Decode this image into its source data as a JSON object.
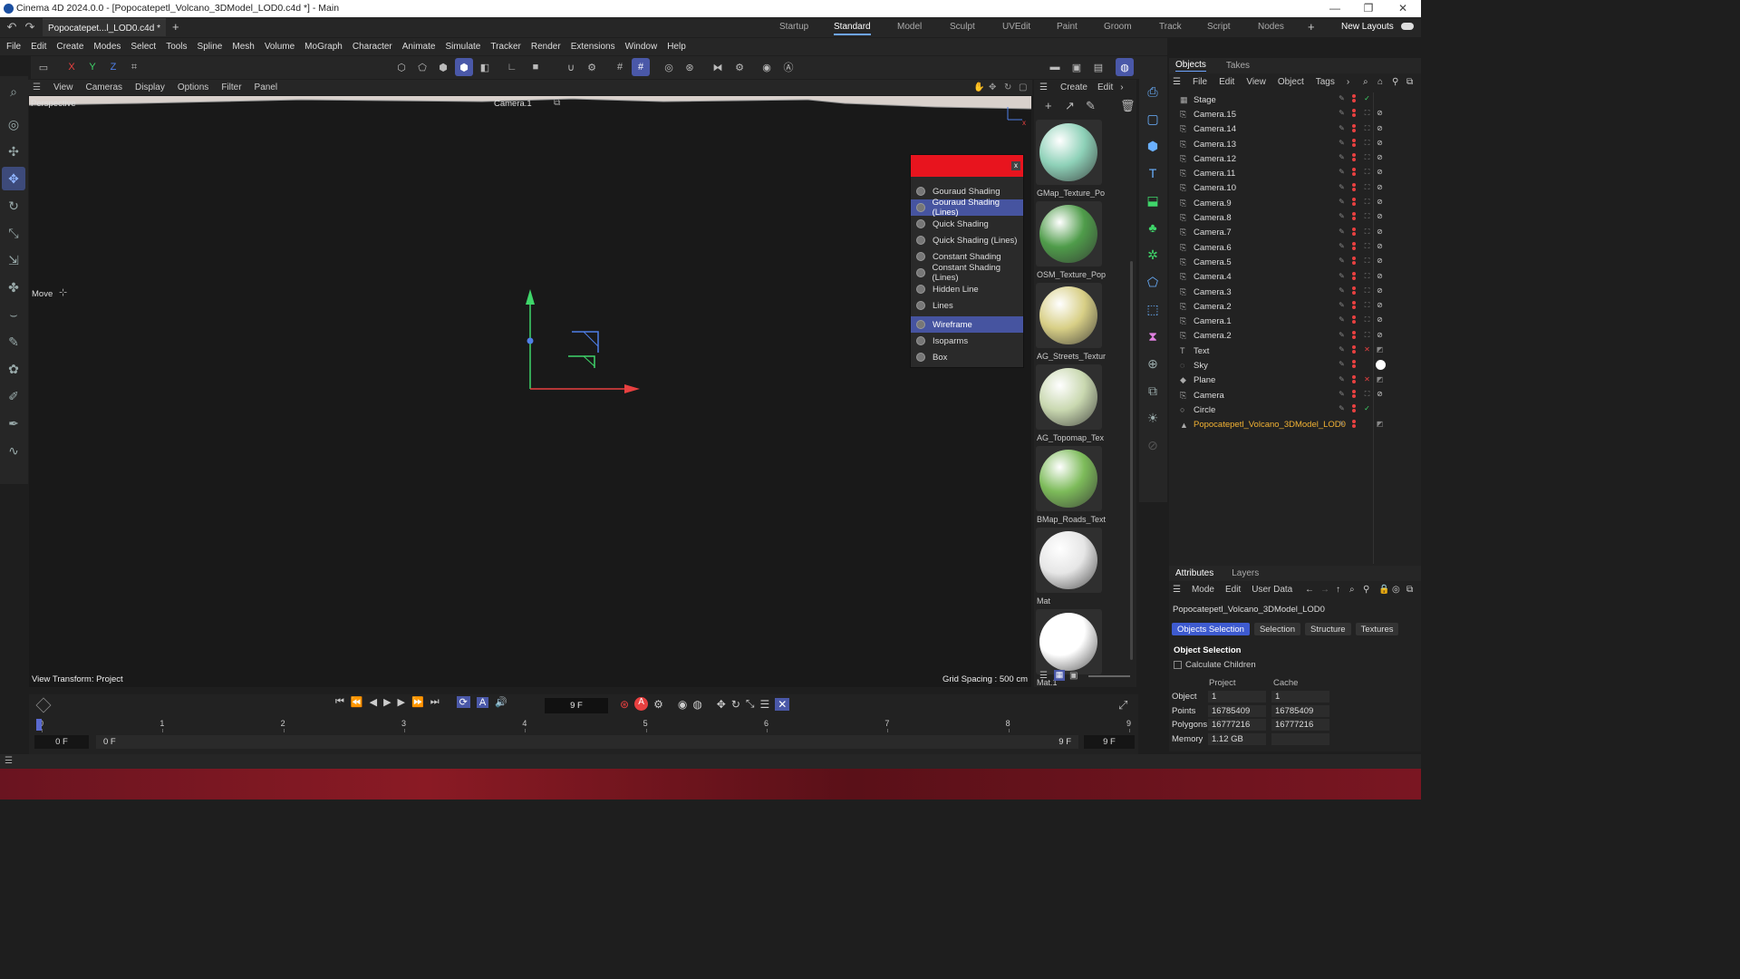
{
  "titlebar": {
    "title": "Cinema 4D 2024.0.0 - [Popocatepetl_Volcano_3DModel_LOD0.c4d *] - Main",
    "minimize": "—",
    "maximize": "❐",
    "close": "✕"
  },
  "doc_tab": {
    "label": "Popocatepet...l_LOD0.c4d *",
    "close": "✕",
    "add": "+"
  },
  "layouts": [
    {
      "label": "Startup",
      "active": false
    },
    {
      "label": "Standard",
      "active": true
    },
    {
      "label": "Model",
      "active": false
    },
    {
      "label": "Sculpt",
      "active": false
    },
    {
      "label": "UVEdit",
      "active": false
    },
    {
      "label": "Paint",
      "active": false
    },
    {
      "label": "Groom",
      "active": false
    },
    {
      "label": "Track",
      "active": false
    },
    {
      "label": "Script",
      "active": false
    },
    {
      "label": "Nodes",
      "active": false
    }
  ],
  "new_layouts": "New Layouts",
  "menu": [
    "File",
    "Edit",
    "Create",
    "Modes",
    "Select",
    "Tools",
    "Spline",
    "Mesh",
    "Volume",
    "MoGraph",
    "Character",
    "Animate",
    "Simulate",
    "Tracker",
    "Render",
    "Extensions",
    "Window",
    "Help"
  ],
  "axis_toggles": [
    "X",
    "Y",
    "Z"
  ],
  "viewport_menu": [
    "View",
    "Cameras",
    "Display",
    "Options",
    "Filter",
    "Panel"
  ],
  "viewport": {
    "name": "Perspective",
    "camera": "Camera.1",
    "tool": "Move",
    "view_transform": "View Transform: Project",
    "grid_spacing": "Grid Spacing : 500 cm"
  },
  "shading_popup": {
    "close": "x",
    "items": [
      {
        "label": "Gouraud Shading",
        "selected": false
      },
      {
        "label": "Gouraud Shading (Lines)",
        "selected": true
      },
      {
        "label": "Quick Shading",
        "selected": false
      },
      {
        "label": "Quick Shading (Lines)",
        "selected": false
      },
      {
        "label": "Constant Shading",
        "selected": false
      },
      {
        "label": "Constant Shading (Lines)",
        "selected": false
      },
      {
        "label": "Hidden Line",
        "selected": false
      },
      {
        "label": "Lines",
        "selected": false
      }
    ],
    "items2": [
      {
        "label": "Wireframe",
        "selected": true
      },
      {
        "label": "Isoparms",
        "selected": false
      },
      {
        "label": "Box",
        "selected": false
      }
    ]
  },
  "material_menu": [
    "Create",
    "Edit"
  ],
  "materials": [
    {
      "name": "GMap_Texture_Po",
      "color": "#8ed1b8"
    },
    {
      "name": "OSM_Texture_Pop",
      "color": "#4f9c4a"
    },
    {
      "name": "AG_Streets_Textur",
      "color": "#d8cf86"
    },
    {
      "name": "AG_Topomap_Tex",
      "color": "#c9d8b0"
    },
    {
      "name": "BMap_Roads_Text",
      "color": "#7dbb5a"
    },
    {
      "name": "Mat",
      "color": "#e6e6e6"
    },
    {
      "name": "Mat.1",
      "color": "#ffffff"
    }
  ],
  "objects_tabs": [
    "Objects",
    "Takes"
  ],
  "objects_menu": [
    "File",
    "Edit",
    "View",
    "Object",
    "Tags"
  ],
  "objects": [
    {
      "name": "Stage",
      "icon": "stage-icon",
      "glyph": "▦",
      "tag": "check"
    },
    {
      "name": "Camera.15",
      "icon": "camera-icon",
      "glyph": "⎘",
      "tag": "target"
    },
    {
      "name": "Camera.14",
      "icon": "camera-icon",
      "glyph": "⎘",
      "tag": "target"
    },
    {
      "name": "Camera.13",
      "icon": "camera-icon",
      "glyph": "⎘",
      "tag": "target"
    },
    {
      "name": "Camera.12",
      "icon": "camera-icon",
      "glyph": "⎘",
      "tag": "target"
    },
    {
      "name": "Camera.11",
      "icon": "camera-icon",
      "glyph": "⎘",
      "tag": "target"
    },
    {
      "name": "Camera.10",
      "icon": "camera-icon",
      "glyph": "⎘",
      "tag": "target"
    },
    {
      "name": "Camera.9",
      "icon": "camera-icon",
      "glyph": "⎘",
      "tag": "target"
    },
    {
      "name": "Camera.8",
      "icon": "camera-icon",
      "glyph": "⎘",
      "tag": "target"
    },
    {
      "name": "Camera.7",
      "icon": "camera-icon",
      "glyph": "⎘",
      "tag": "target"
    },
    {
      "name": "Camera.6",
      "icon": "camera-icon",
      "glyph": "⎘",
      "tag": "target"
    },
    {
      "name": "Camera.5",
      "icon": "camera-icon",
      "glyph": "⎘",
      "tag": "target"
    },
    {
      "name": "Camera.4",
      "icon": "camera-icon",
      "glyph": "⎘",
      "tag": "target"
    },
    {
      "name": "Camera.3",
      "icon": "camera-icon",
      "glyph": "⎘",
      "tag": "target"
    },
    {
      "name": "Camera.2",
      "icon": "camera-icon",
      "glyph": "⎘",
      "tag": "target"
    },
    {
      "name": "Camera.1",
      "icon": "camera-icon",
      "glyph": "⎘",
      "tag": "target"
    },
    {
      "name": "Camera.2",
      "icon": "camera-icon",
      "glyph": "⎘",
      "tag": "target"
    },
    {
      "name": "Text",
      "icon": "text-icon",
      "glyph": "T",
      "tag": "x"
    },
    {
      "name": "Sky",
      "icon": "sky-icon",
      "glyph": "◌",
      "tag": "ball"
    },
    {
      "name": "Plane",
      "icon": "plane-icon",
      "glyph": "◆",
      "tag": "x"
    },
    {
      "name": "Camera",
      "icon": "camera-icon",
      "glyph": "⎘",
      "tag": "target"
    },
    {
      "name": "Circle",
      "icon": "circle-icon",
      "glyph": "○",
      "tag": "check"
    },
    {
      "name": "Popocatepetl_Volcano_3DModel_LOD0",
      "icon": "polygon-icon",
      "glyph": "▲",
      "tag": "mat",
      "highlight": true
    }
  ],
  "attributes": {
    "tabs": [
      "Attributes",
      "Layers"
    ],
    "menu": [
      "Mode",
      "Edit",
      "User Data"
    ],
    "object_name": "Popocatepetl_Volcano_3DModel_LOD0",
    "subtabs": [
      {
        "label": "Objects Selection",
        "active": true
      },
      {
        "label": "Selection",
        "active": false
      },
      {
        "label": "Structure",
        "active": false
      },
      {
        "label": "Textures",
        "active": false
      }
    ],
    "section": "Object Selection",
    "calc_children": "Calculate Children",
    "col_project": "Project",
    "col_cache": "Cache",
    "rows": [
      {
        "label": "Object",
        "project": "1",
        "cache": "1"
      },
      {
        "label": "Points",
        "project": "16785409",
        "cache": "16785409"
      },
      {
        "label": "Polygons",
        "project": "16777216",
        "cache": "16777216"
      },
      {
        "label": "Memory",
        "project": "1.12 GB",
        "cache": ""
      }
    ]
  },
  "timeline": {
    "current_frame": "9 F",
    "ticks": [
      "0",
      "1",
      "2",
      "3",
      "4",
      "5",
      "6",
      "7",
      "8",
      "9"
    ],
    "start": "0 F",
    "start2": "0 F",
    "end": "9 F",
    "end2": "9 F"
  },
  "colors": {
    "accent": "#4a58a8",
    "popup_header": "#e8141e",
    "x_axis": "#e84040",
    "y_axis": "#3fd66a",
    "z_axis": "#4f7fe8"
  }
}
